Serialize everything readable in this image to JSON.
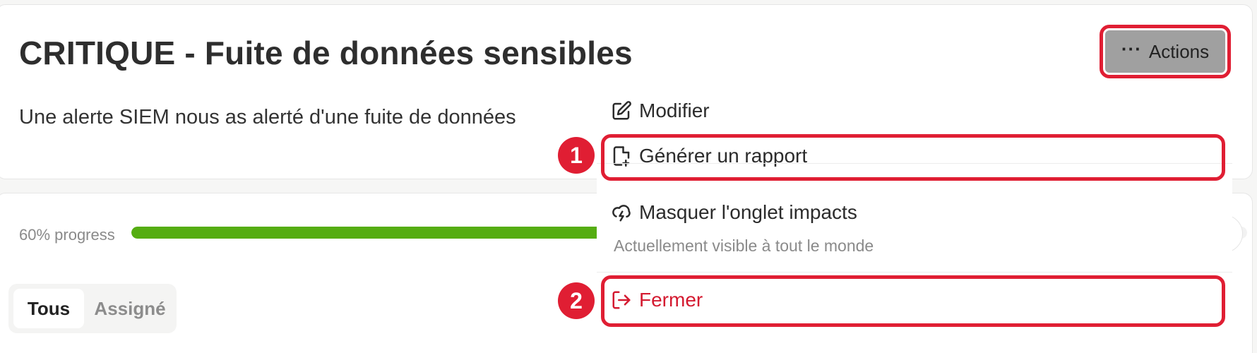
{
  "header": {
    "title": "CRITIQUE - Fuite de données sensibles",
    "description": "Une alerte SIEM nous as alerté d'une fuite de données",
    "actions_label": "Actions",
    "actions_icon": "ellipsis-icon"
  },
  "progress": {
    "label": "60% progress",
    "value": 0.6,
    "fill_color": "#55ad12"
  },
  "filters": {
    "tabs": [
      {
        "label": "Tous",
        "selected": true
      },
      {
        "label": "Assigné",
        "selected": false
      }
    ]
  },
  "menu": {
    "items": [
      {
        "label": "Modifier",
        "icon": "edit-icon"
      },
      {
        "label": "Générer un rapport",
        "icon": "file-plus-icon"
      },
      {
        "label": "Masquer l'onglet impacts",
        "icon": "cloud-lightning-icon",
        "sublabel": "Actuellement visible à tout le monde"
      },
      {
        "label": "Fermer",
        "icon": "logout-icon",
        "color": "#d41a30"
      }
    ]
  },
  "annotations": {
    "accent_color": "#e01e33",
    "steps": [
      "1",
      "2"
    ]
  }
}
